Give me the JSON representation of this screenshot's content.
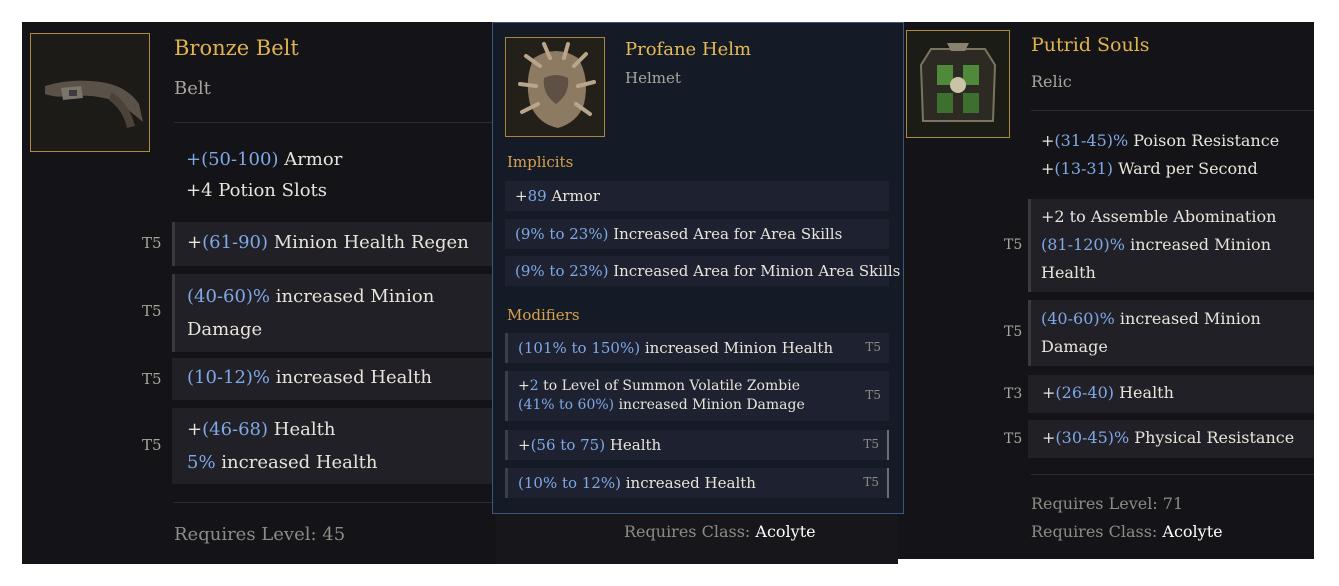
{
  "left_item": {
    "name": "Bronze Belt",
    "type": "Belt",
    "implicit_lines": [
      {
        "blue": "+(50-100)",
        "text": " Armor"
      },
      {
        "blue": "",
        "text": "+4 Potion Slots"
      }
    ],
    "mods": [
      {
        "tier": "T5",
        "lines": [
          {
            "pre": "+",
            "blue": "(61-90)",
            "text": " Minion Health Regen"
          }
        ]
      },
      {
        "tier": "T5",
        "lines": [
          {
            "pre": "",
            "blue": "(40-60)%",
            "text": " increased Minion"
          },
          {
            "pre": "",
            "blue": "",
            "text": "Damage"
          }
        ]
      },
      {
        "tier": "T5",
        "lines": [
          {
            "pre": "",
            "blue": "(10-12)%",
            "text": " increased Health"
          }
        ]
      },
      {
        "tier": "T5",
        "lines": [
          {
            "pre": "+",
            "blue": "(46-68)",
            "text": " Health"
          },
          {
            "pre": "",
            "blue": "5%",
            "text": " increased Health"
          }
        ]
      }
    ],
    "requires_level_label": "Requires Level: 45"
  },
  "middle_item": {
    "requires_class_label": "Requires Class: ",
    "requires_class_value": "Acolyte"
  },
  "tooltip": {
    "name": "Profane Helm",
    "type": "Helmet",
    "implicits_header": "Implicits",
    "implicits": [
      {
        "pre": "+",
        "blue": "89",
        "text": " Armor"
      },
      {
        "pre": "",
        "blue": "(9% to 23%)",
        "text": " Increased Area for Area Skills"
      },
      {
        "pre": "",
        "blue": "(9% to 23%)",
        "text": " Increased Area for Minion Area Skills"
      }
    ],
    "modifiers_header": "Modifiers",
    "modifiers": [
      {
        "tier": "T5",
        "lines": [
          {
            "pre": "",
            "blue": "(101% to 150%)",
            "text": " increased Minion Health"
          }
        ]
      },
      {
        "tier": "T5",
        "lines": [
          {
            "pre": "+",
            "blue": "2",
            "text": " to Level of Summon Volatile Zombie"
          },
          {
            "pre": "",
            "blue": "(41% to 60%)",
            "text": " increased Minion Damage"
          }
        ]
      },
      {
        "tier": "T5",
        "lines": [
          {
            "pre": "+",
            "blue": "(56 to 75)",
            "text": " Health"
          }
        ]
      },
      {
        "tier": "T5",
        "lines": [
          {
            "pre": "",
            "blue": "(10% to 12%)",
            "text": " increased Health"
          }
        ]
      }
    ]
  },
  "right_item": {
    "name": "Putrid Souls",
    "type": "Relic",
    "implicit_lines": [
      {
        "pre": "+",
        "blue": "(31-45)%",
        "text": " Poison Resistance"
      },
      {
        "pre": "+",
        "blue": "(13-31)",
        "text": " Ward per Second"
      }
    ],
    "mods": [
      {
        "tier": "T5",
        "lines": [
          {
            "pre": "+2",
            "blue": "",
            "text": " to Assemble Abomination"
          },
          {
            "pre": "",
            "blue": "(81-120)%",
            "text": " increased Minion"
          },
          {
            "pre": "",
            "blue": "",
            "text": "Health"
          }
        ]
      },
      {
        "tier": "T5",
        "lines": [
          {
            "pre": "",
            "blue": "(40-60)%",
            "text": " increased Minion"
          },
          {
            "pre": "",
            "blue": "",
            "text": "Damage"
          }
        ]
      },
      {
        "tier": "T3",
        "lines": [
          {
            "pre": "+",
            "blue": "(26-40)",
            "text": " Health"
          }
        ]
      },
      {
        "tier": "T5",
        "lines": [
          {
            "pre": "+",
            "blue": "(30-45)%",
            "text": " Physical Resistance"
          }
        ]
      }
    ],
    "requires_level_label": "Requires Level: ",
    "requires_level_value": "71",
    "requires_class_label": "Requires Class: ",
    "requires_class_value": "Acolyte"
  },
  "colors": {
    "title_gold": "#e0b34e",
    "value_blue": "#7fa8e6",
    "section_orange": "#d8a04c",
    "tooltip_border": "#3c5778"
  }
}
